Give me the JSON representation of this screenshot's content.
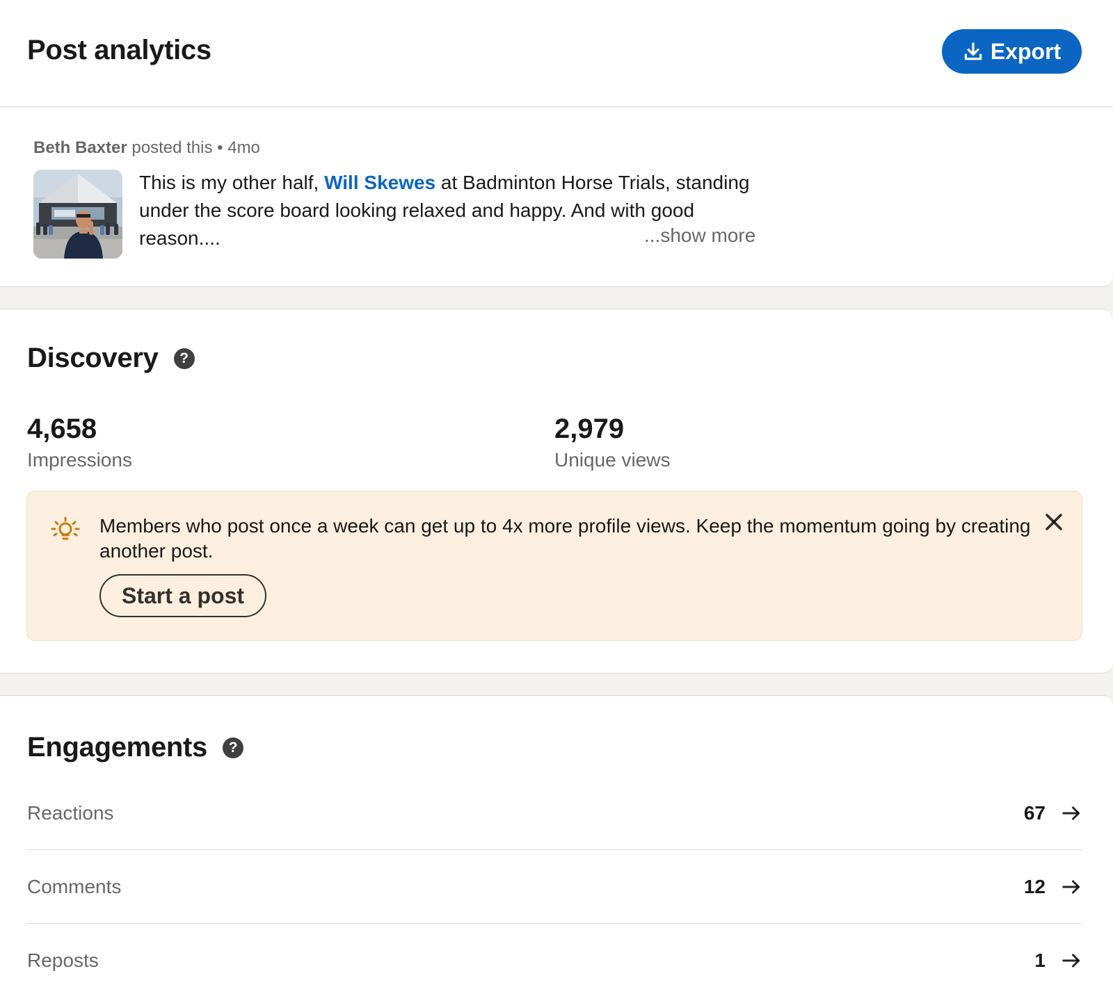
{
  "header": {
    "title": "Post analytics",
    "export_label": "Export",
    "export_icon": "download-icon",
    "accent_color": "#0a66c2"
  },
  "post": {
    "author": "Beth Baxter",
    "posted_text": "posted this",
    "separator": "•",
    "age": "4mo",
    "text_before_mention": "This is my other half, ",
    "mention": "Will Skewes",
    "text_after_mention": " at Badminton Horse Trials, standing under the score board looking relaxed and happy. And with good reason....",
    "show_more": "...show more"
  },
  "discovery": {
    "title": "Discovery",
    "help_glyph": "?",
    "metrics": [
      {
        "value": "4,658",
        "label": "Impressions"
      },
      {
        "value": "2,979",
        "label": "Unique views"
      }
    ],
    "tip": {
      "icon": "lightbulb-icon",
      "text": "Members who post once a week can get up to 4x more profile views. Keep the momentum going by creating another post.",
      "button_label": "Start a post",
      "background_color": "#fcefdf"
    }
  },
  "engagements": {
    "title": "Engagements",
    "help_glyph": "?",
    "rows": [
      {
        "label": "Reactions",
        "value": "67"
      },
      {
        "label": "Comments",
        "value": "12"
      },
      {
        "label": "Reposts",
        "value": "1"
      }
    ]
  }
}
